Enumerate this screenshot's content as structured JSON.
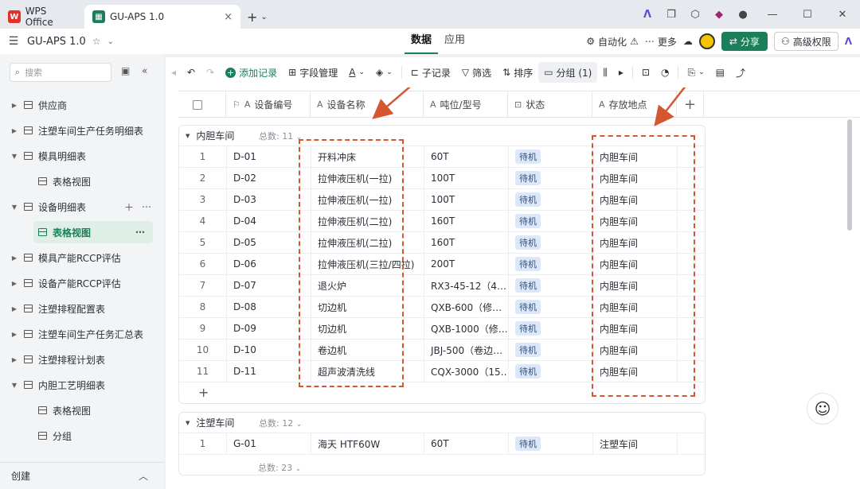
{
  "titlebar": {
    "wps_tab": "WPS Office",
    "doc_tab": "GU-APS 1.0",
    "close": "×",
    "plus": "+",
    "dropdown": "⌄"
  },
  "appbar": {
    "title": "GU-APS 1.0",
    "tabs": [
      "数据",
      "应用"
    ],
    "automation": "自动化",
    "more": "更多",
    "share": "分享",
    "permission": "高级权限"
  },
  "sidebar": {
    "search_placeholder": "搜索",
    "items": [
      {
        "label": "供应商",
        "level": 0
      },
      {
        "label": "注塑车间生产任务明细表",
        "level": 0
      },
      {
        "label": "模具明细表",
        "level": 0
      },
      {
        "label": "表格视图",
        "level": 1
      },
      {
        "label": "设备明细表",
        "level": 0
      },
      {
        "label": "表格视图",
        "level": 1
      },
      {
        "label": "模具产能RCCP评估",
        "level": 0
      },
      {
        "label": "设备产能RCCP评估",
        "level": 0
      },
      {
        "label": "注塑排程配置表",
        "level": 0
      },
      {
        "label": "注塑车间生产任务汇总表",
        "level": 0
      },
      {
        "label": "注塑排程计划表",
        "level": 0
      },
      {
        "label": "内胆工艺明细表",
        "level": 0
      },
      {
        "label": "表格视图",
        "level": 1
      },
      {
        "label": "分组",
        "level": 1
      }
    ],
    "create": "创建"
  },
  "toolbar": {
    "add_record": "添加记录",
    "field_manage": "字段管理",
    "font_a": "A",
    "sub_record": "子记录",
    "filter": "筛选",
    "sort": "排序",
    "group": "分组 (1)"
  },
  "columns": [
    "设备编号",
    "设备名称",
    "吨位/型号",
    "状态",
    "存放地点"
  ],
  "groups": [
    {
      "name": "内胆车间",
      "count_label": "总数: 11",
      "rows": [
        [
          "1",
          "D-01",
          "开料冲床",
          "60T",
          "待机",
          "内胆车间"
        ],
        [
          "2",
          "D-02",
          "拉伸液压机(一拉)",
          "100T",
          "待机",
          "内胆车间"
        ],
        [
          "3",
          "D-03",
          "拉伸液压机(一拉)",
          "100T",
          "待机",
          "内胆车间"
        ],
        [
          "4",
          "D-04",
          "拉伸液压机(二拉)",
          "160T",
          "待机",
          "内胆车间"
        ],
        [
          "5",
          "D-05",
          "拉伸液压机(二拉)",
          "160T",
          "待机",
          "内胆车间"
        ],
        [
          "6",
          "D-06",
          "拉伸液压机(三拉/四拉)",
          "200T",
          "待机",
          "内胆车间"
        ],
        [
          "7",
          "D-07",
          "退火炉",
          "RX3-45-12（4…",
          "待机",
          "内胆车间"
        ],
        [
          "8",
          "D-08",
          "切边机",
          "QXB-600（修…",
          "待机",
          "内胆车间"
        ],
        [
          "9",
          "D-09",
          "切边机",
          "QXB-1000（修…",
          "待机",
          "内胆车间"
        ],
        [
          "10",
          "D-10",
          "卷边机",
          "JBJ-500（卷边…",
          "待机",
          "内胆车间"
        ],
        [
          "11",
          "D-11",
          "超声波清洗线",
          "CQX-3000（15…",
          "待机",
          "内胆车间"
        ]
      ]
    },
    {
      "name": "注塑车间",
      "count_label": "总数: 12",
      "rows": [
        [
          "1",
          "G-01",
          "海天 HTF60W",
          "60T",
          "待机",
          "注塑车间"
        ]
      ]
    }
  ],
  "total_label": "总数: 23",
  "colors": {
    "accent": "#1a7f5a",
    "annotation": "#d4572f",
    "status_bg": "#dce8f9"
  }
}
